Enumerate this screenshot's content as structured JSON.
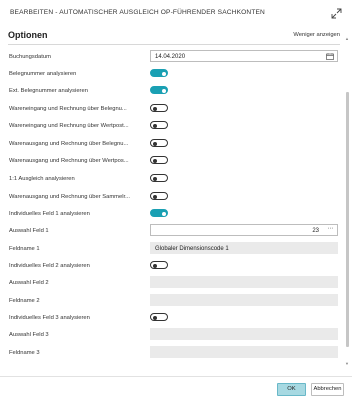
{
  "header": {
    "title": "BEARBEITEN - AUTOMATISCHER AUSGLEICH OP-FÜHRENDER SACHKONTEN",
    "expand_icon": "expand-icon"
  },
  "section": {
    "title": "Optionen",
    "toggle_label": "Weniger anzeigen"
  },
  "fields": [
    {
      "label": "Buchungsdatum",
      "kind": "date",
      "value": "14.04.2020"
    },
    {
      "label": "Belegnummer analysieren",
      "kind": "toggle",
      "on": true
    },
    {
      "label": "Ext. Belegnummer analysieren",
      "kind": "toggle",
      "on": true
    },
    {
      "label": "Wareneingang und Rechnung über Belegnu...",
      "kind": "toggle",
      "on": false
    },
    {
      "label": "Wareneingang und Rechnung über Wertpost...",
      "kind": "toggle",
      "on": false
    },
    {
      "label": "Warenausgang und Rechnung über Belegnu...",
      "kind": "toggle",
      "on": false
    },
    {
      "label": "Warenausgang und Rechnung über Wertpos...",
      "kind": "toggle",
      "on": false
    },
    {
      "label": "1:1 Ausgleich analysieren",
      "kind": "toggle",
      "on": false
    },
    {
      "label": "Warenausgang und Rechnung über Sammelr...",
      "kind": "toggle",
      "on": false
    },
    {
      "label": "Individuelles Feld 1 analysieren",
      "kind": "toggle",
      "on": true
    },
    {
      "label": "Auswahl Feld 1",
      "kind": "number",
      "value": "23"
    },
    {
      "label": "Feldname 1",
      "kind": "readonly",
      "value": "Globaler Dimensionscode 1"
    },
    {
      "label": "Individuelles Feld 2 analysieren",
      "kind": "toggle",
      "on": false
    },
    {
      "label": "Auswahl Feld 2",
      "kind": "readonly",
      "value": ""
    },
    {
      "label": "Feldname 2",
      "kind": "readonly",
      "value": ""
    },
    {
      "label": "Individuelles Feld 3 analysieren",
      "kind": "toggle",
      "on": false
    },
    {
      "label": "Auswahl Feld 3",
      "kind": "readonly",
      "value": ""
    },
    {
      "label": "Feldname 3",
      "kind": "readonly",
      "value": ""
    }
  ],
  "footer": {
    "ok_label": "OK",
    "cancel_label": "Abbrechen"
  },
  "colors": {
    "toggle_on": "#1aa0b3",
    "ok_button": "#a7d9e2"
  }
}
